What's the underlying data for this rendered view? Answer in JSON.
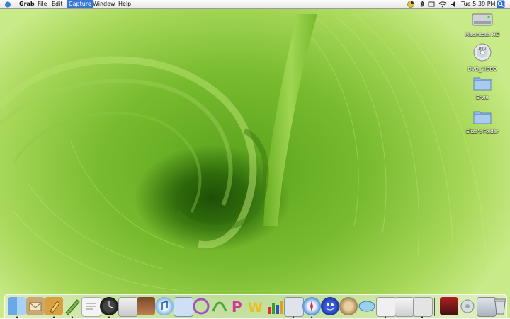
{
  "menubar": {
    "app_name": "Grab",
    "menus": [
      "File",
      "Edit",
      "Capture",
      "Window",
      "Help"
    ],
    "active_menu": "Capture",
    "clock": "Tue 5:39 PM"
  },
  "desktop": {
    "icons": [
      {
        "label": "Macintosh HD",
        "icon": "hard-drive-icon"
      },
      {
        "label": "DVD_VIDEO",
        "icon": "dvd-icon"
      },
      {
        "label": "Ervie",
        "icon": "folder-icon"
      },
      {
        "label": "Eliza's Folder",
        "icon": "folder-icon"
      }
    ]
  },
  "dock": {
    "items": [
      "finder",
      "mail",
      "address-book",
      "pencil-app",
      "textedit",
      "clock",
      "disk-utility",
      "iphoto",
      "itunes",
      "preview",
      "ichat",
      "system-tool",
      "photoshop",
      "word",
      "chart-app",
      "sketch-app",
      "safari",
      "aim",
      "sound-app",
      "network-app",
      "notes-app",
      "apple-app",
      "scissors-app",
      "photo-app",
      "mixer",
      "trash"
    ]
  }
}
